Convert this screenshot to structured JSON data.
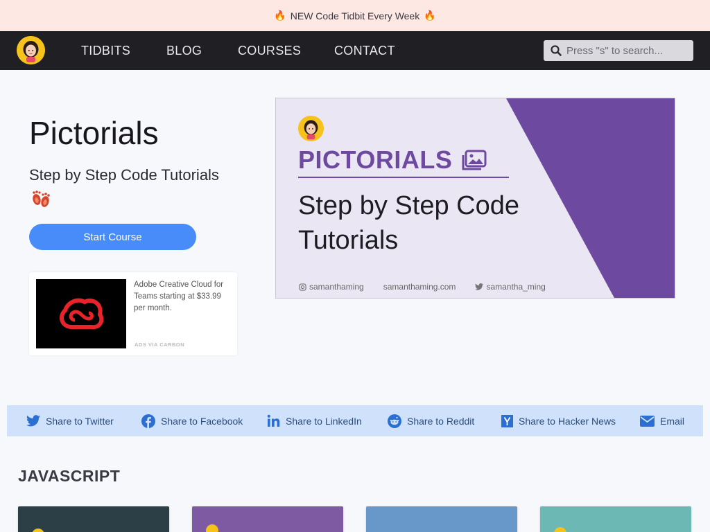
{
  "announcement": {
    "text": "NEW Code Tidbit Every Week"
  },
  "nav": {
    "links": [
      "TIDBITS",
      "BLOG",
      "COURSES",
      "CONTACT"
    ],
    "search_placeholder": "Press \"s\" to search..."
  },
  "hero": {
    "title": "Pictorials",
    "subtitle": "Step by Step Code Tutorials",
    "cta_label": "Start Course"
  },
  "ad": {
    "text": "Adobe Creative Cloud for Teams starting at $33.99 per month.",
    "via": "ADS VIA CARBON"
  },
  "banner": {
    "title": "PICTORIALS",
    "subtitle": "Step by Step Code Tutorials",
    "footer": {
      "instagram": "samanthaming",
      "website": "samanthaming.com",
      "twitter": "samantha_ming"
    }
  },
  "share": [
    {
      "label": "Share to Twitter",
      "icon": "twitter-icon"
    },
    {
      "label": "Share to Facebook",
      "icon": "facebook-icon"
    },
    {
      "label": "Share to LinkedIn",
      "icon": "linkedin-icon"
    },
    {
      "label": "Share to Reddit",
      "icon": "reddit-icon"
    },
    {
      "label": "Share to Hacker News",
      "icon": "hacker-news-icon"
    },
    {
      "label": "Email",
      "icon": "email-icon"
    }
  ],
  "section": {
    "title": "JAVASCRIPT"
  },
  "colors": {
    "accent": "#478cf8",
    "nav_bg": "#1f1f24",
    "announce_bg": "#fde8e4",
    "share_bg": "#cfe1fb",
    "banner_purple": "#6d4a9f",
    "card_colors": [
      "#2c3e46",
      "#7e5aa2",
      "#6798c9",
      "#6cb8b4"
    ]
  }
}
